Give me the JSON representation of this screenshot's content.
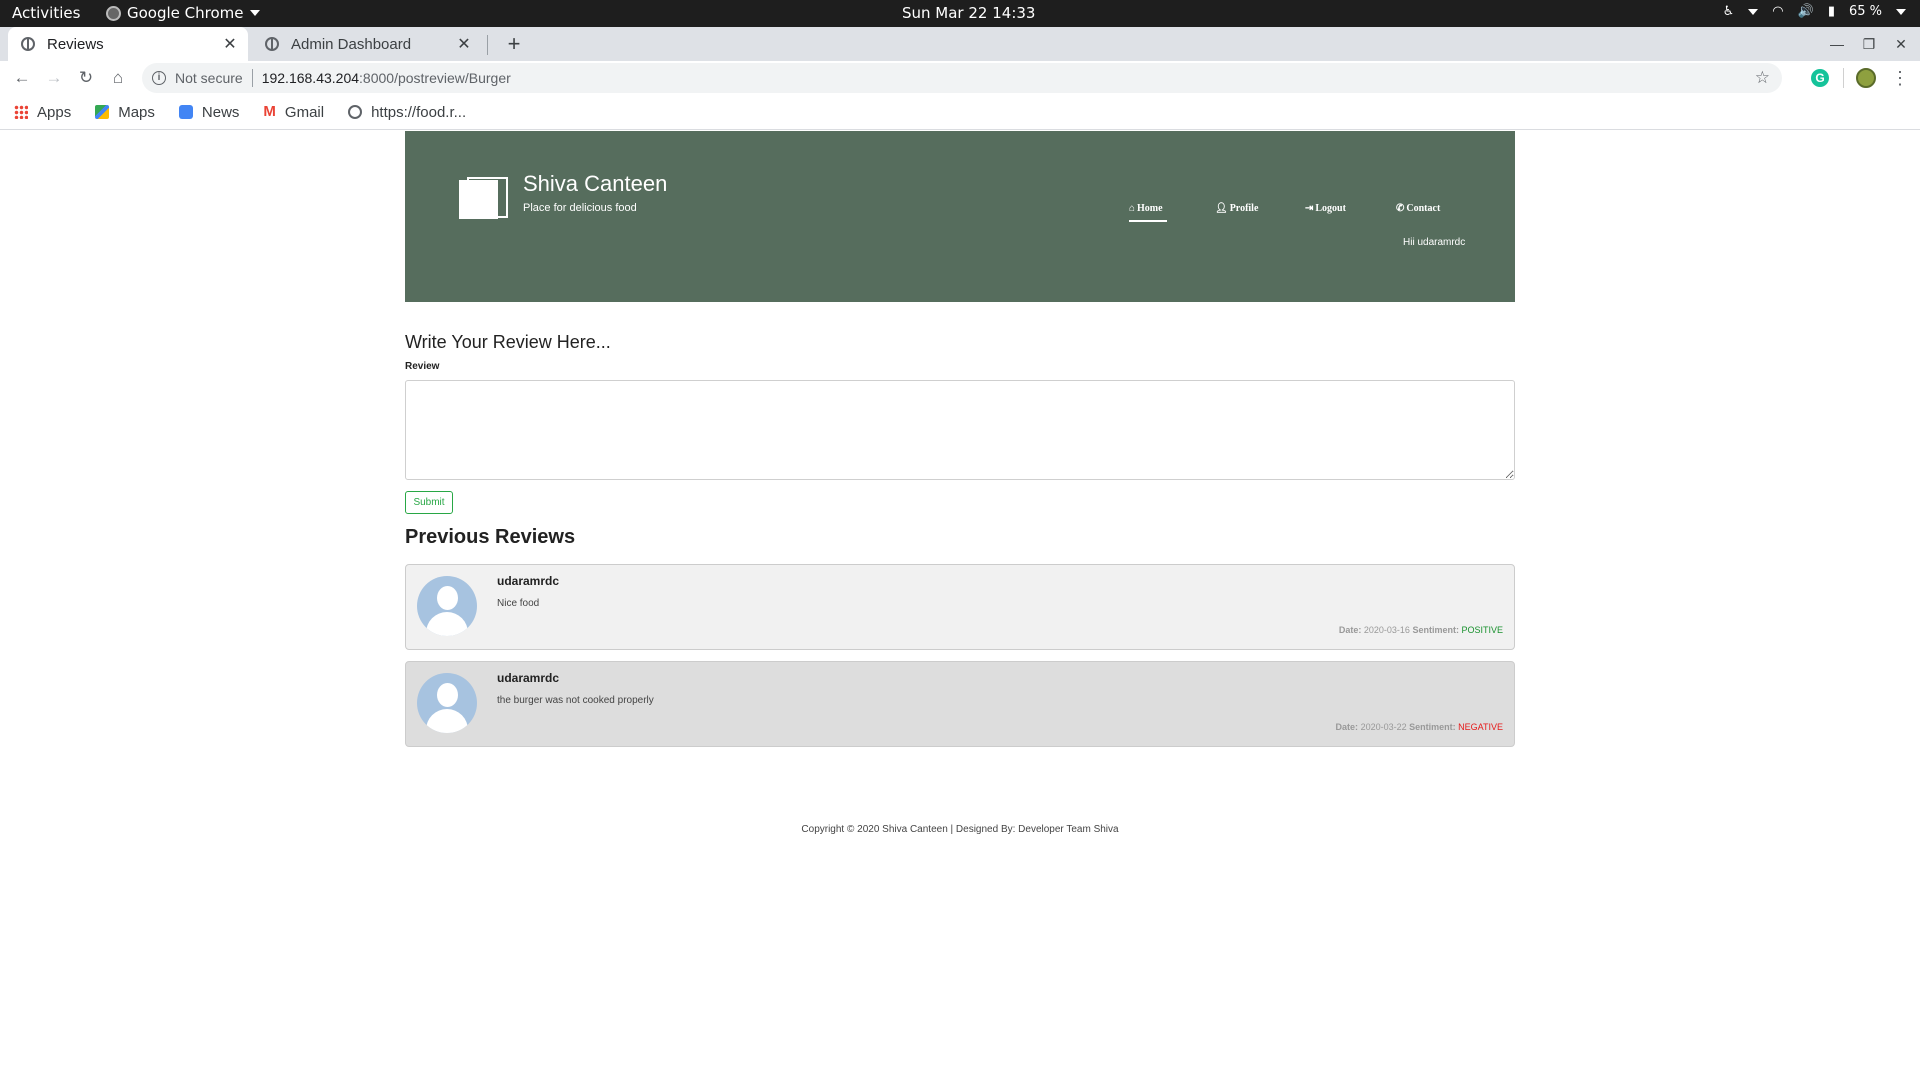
{
  "system": {
    "activities": "Activities",
    "app_name": "Google Chrome",
    "clock": "Sun Mar 22  14:33",
    "battery": "65 %"
  },
  "browser": {
    "tabs": [
      {
        "title": "Reviews",
        "close": "✕"
      },
      {
        "title": "Admin Dashboard",
        "close": "✕"
      }
    ],
    "new_tab": "+",
    "security_label": "Not secure",
    "url_host": "192.168.43.204",
    "url_path": ":8000/postreview/Burger",
    "bookmarks": [
      "Apps",
      "Maps",
      "News",
      "Gmail",
      "https://food.r..."
    ]
  },
  "site": {
    "brand_title": "Shiva Canteen",
    "brand_tagline": "Place for delicious food",
    "nav": {
      "home": "Home",
      "profile": "Profile",
      "logout": "Logout",
      "contact": "Contact"
    },
    "greeting": "Hii udaramrdc"
  },
  "review_form": {
    "heading": "Write Your Review Here...",
    "label": "Review",
    "value": "",
    "submit_label": "Submit"
  },
  "previous_reviews": {
    "heading": "Previous Reviews",
    "date_label": "Date:",
    "sentiment_label": "Sentiment:",
    "items": [
      {
        "user": "udaramrdc",
        "text": "Nice food",
        "date": "2020-03-16",
        "sentiment": "POSITIVE"
      },
      {
        "user": "udaramrdc",
        "text": "the burger was not cooked properly",
        "date": "2020-03-22",
        "sentiment": "NEGATIVE"
      }
    ]
  },
  "footer": {
    "text": "Copyright © 2020 Shiva Canteen | Designed By: Developer Team Shiva"
  },
  "colors": {
    "header_bg": "#566d5d",
    "positive": "#19912e",
    "negative": "#e61a1a",
    "submit_accent": "#28a745"
  }
}
